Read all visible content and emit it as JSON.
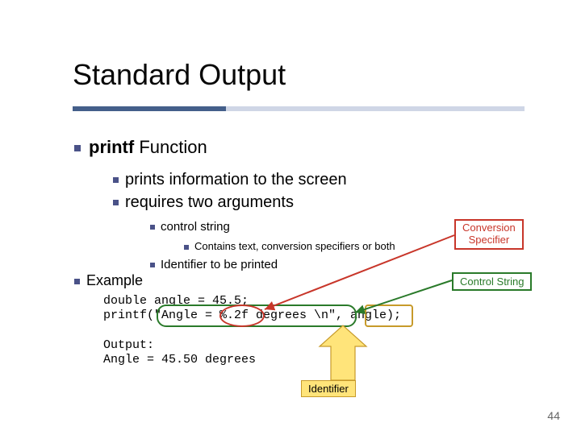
{
  "title": "Standard Output",
  "bullets": {
    "printf": "printf",
    "printf_suffix": " Function",
    "sub1": "prints information to the screen",
    "sub2": "requires two arguments",
    "sub2a": "control string",
    "sub2a_i": "Contains text, conversion specifiers or both",
    "sub2b": "Identifier to be printed",
    "example": "Example"
  },
  "code": {
    "line1": "double angle = 45.5;",
    "line2": "printf(\"Angle = %.2f degrees \\n\", angle);"
  },
  "output": {
    "label": "Output:",
    "line": "Angle = 45.50 degrees"
  },
  "labels": {
    "conversion": "Conversion\nSpecifier",
    "control": "Control String",
    "identifier": "Identifier"
  },
  "page_number": "44"
}
